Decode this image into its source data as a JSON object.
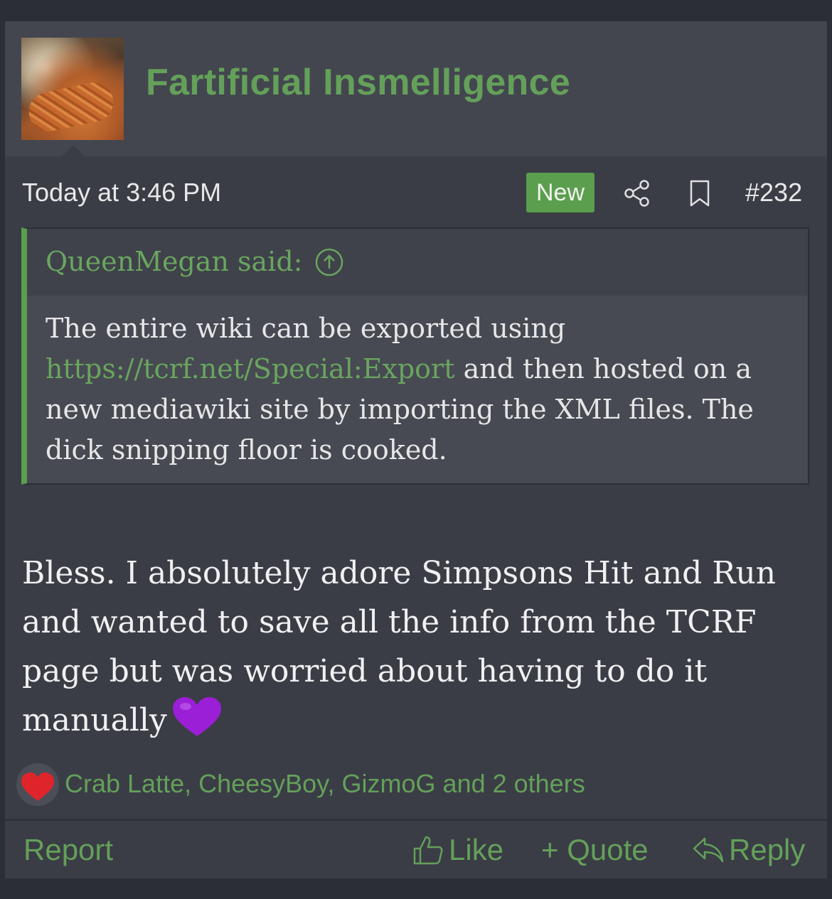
{
  "post": {
    "username": "Fartificial Insmelligence",
    "date": "Today at 3:46 PM",
    "badge": "New",
    "post_number": "#232",
    "quote": {
      "attribution": "QueenMegan said:",
      "line1": "The entire wiki can be exported using",
      "link": "https://tcrf.net/Special:Export",
      "line2_rest": " and then hosted on a",
      "line3": "new mediawiki site by importing the XML files. The",
      "line4": "dick snipping floor is cooked."
    },
    "message": {
      "line1": "Bless. I absolutely adore Simpsons Hit and Run",
      "line2": "and wanted to save all the info from the TCRF",
      "line3": "page but was worried about having to do it",
      "line4": "manually"
    },
    "reactions": {
      "text": "Crab Latte, CheesyBoy, GizmoG and 2 others"
    },
    "footer": {
      "report": "Report",
      "like": "Like",
      "quote": "+ Quote",
      "reply": "Reply"
    }
  },
  "colors": {
    "background": "#2b2e34",
    "panel": "#3a3d45",
    "accent_green": "#64a05a",
    "badge_green": "#5a9e4e",
    "purple_heart": "#9b1fd6",
    "red_heart": "#e0242b"
  },
  "icons": [
    "share-icon",
    "bookmark-icon",
    "arrow-up-circle-icon",
    "purple-heart-emoji",
    "heart-reaction-icon",
    "thumbs-up-icon",
    "reply-arrow-icon"
  ]
}
